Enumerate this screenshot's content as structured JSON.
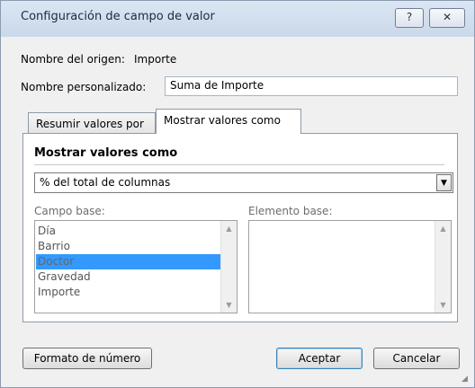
{
  "window": {
    "title": "Configuración de campo de valor",
    "help_label": "?",
    "close_label": "✕"
  },
  "source": {
    "label": "Nombre del origen:",
    "value": "Importe"
  },
  "custom_name": {
    "label": "Nombre personalizado:",
    "value": "Suma de Importe"
  },
  "tabs": [
    {
      "label": "Resumir valores por",
      "active": false
    },
    {
      "label": "Mostrar valores como",
      "active": true
    }
  ],
  "panel": {
    "section_title": "Mostrar valores como",
    "dropdown_value": "% del total de columnas",
    "base_field": {
      "label": "Campo base:",
      "items": [
        "Día",
        "Barrio",
        "Doctor",
        "Gravedad",
        "Importe"
      ],
      "selected": "Doctor"
    },
    "base_item": {
      "label": "Elemento base:",
      "items": []
    }
  },
  "buttons": {
    "number_format": "Formato de número",
    "ok": "Aceptar",
    "cancel": "Cancelar"
  },
  "colors": {
    "selection": "#3399ff",
    "titlebar": "#c9d8ea"
  }
}
